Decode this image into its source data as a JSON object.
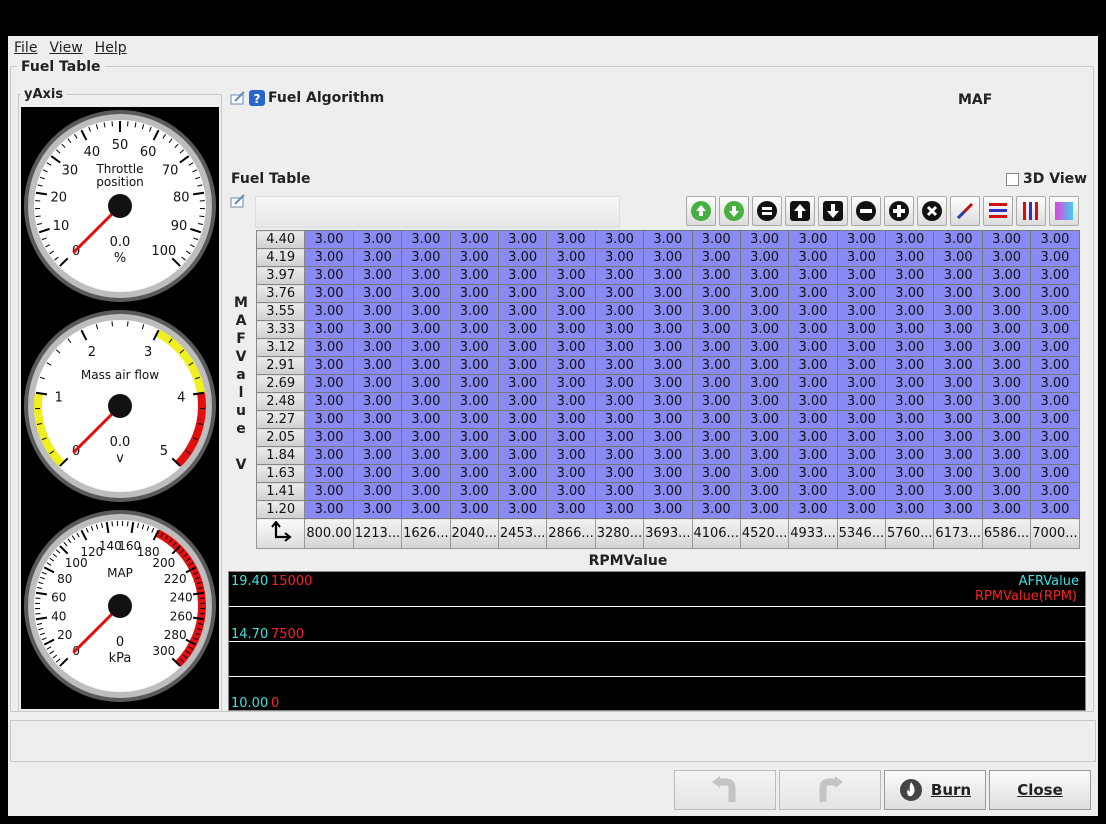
{
  "menu": {
    "file": "File",
    "view": "View",
    "help": "Help"
  },
  "panel_title": "Fuel Table",
  "yaxis_title": "yAxis",
  "gauges": [
    {
      "label_line1": "Throttle",
      "label_line2": "position",
      "value": "0.0",
      "unit": "%",
      "ticks": [
        "0",
        "10",
        "20",
        "30",
        "40",
        "50",
        "60",
        "70",
        "80",
        "90",
        "100"
      ]
    },
    {
      "label_line1": "Mass air flow",
      "label_line2": "",
      "value": "0.0",
      "unit": "v",
      "ticks": [
        "0",
        "1",
        "2",
        "3",
        "4",
        "5"
      ]
    },
    {
      "label_line1": "MAP",
      "label_line2": "",
      "value": "0",
      "unit": "kPa",
      "ticks": [
        "0",
        "20",
        "40",
        "60",
        "80",
        "100",
        "120",
        "140",
        "160",
        "180",
        "200",
        "220",
        "240",
        "260",
        "280",
        "300"
      ]
    }
  ],
  "algorithm": {
    "label": "Fuel Algorithm",
    "value": "MAF"
  },
  "fuel_table": {
    "title": "Fuel Table",
    "view3d_label": "3D View",
    "y_axis_label": [
      "M",
      "A",
      "F",
      "V",
      "a",
      "l",
      "u",
      "e",
      "",
      "V"
    ],
    "y_values": [
      "4.40",
      "4.19",
      "3.97",
      "3.76",
      "3.55",
      "3.33",
      "3.12",
      "2.91",
      "2.69",
      "2.48",
      "2.27",
      "2.05",
      "1.84",
      "1.63",
      "1.41",
      "1.20"
    ],
    "x_values": [
      "800.00",
      "1213...",
      "1626...",
      "2040...",
      "2453...",
      "2866...",
      "3280...",
      "3693...",
      "4106...",
      "4520...",
      "4933...",
      "5346...",
      "5760...",
      "6173...",
      "6586...",
      "7000..."
    ],
    "cell_value": "3.00",
    "x_axis_title": "RPMValue"
  },
  "toolbar": [
    "increment-green-icon",
    "decrement-green-icon",
    "set-equal-icon",
    "shift-up-icon",
    "shift-down-icon",
    "subtract-icon",
    "add-icon",
    "clear-icon",
    "interpolate-icon",
    "horizontal-interpolate-icon",
    "vertical-interpolate-icon",
    "smooth-icon"
  ],
  "graph": {
    "legend1": "AFRValue",
    "legend2": "RPMValue(RPM)",
    "y_left_top": "19.40",
    "y_right_top": "15000",
    "y_left_mid": "14.70",
    "y_right_mid": "7500",
    "y_left_bot": "10.00",
    "y_right_bot": "0"
  },
  "buttons": {
    "burn": "Burn",
    "close": "Close"
  },
  "colors": {
    "cell": "#8a8af4",
    "afr": "#40e0e0",
    "rpm": "#ff2020"
  }
}
